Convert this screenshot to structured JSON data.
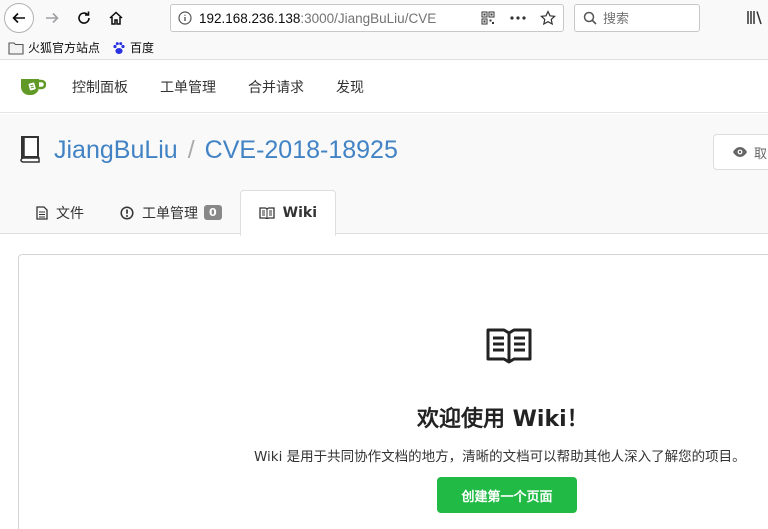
{
  "browser": {
    "url_host": "192.168.236.138",
    "url_rest": ":3000/JiangBuLiu/CVE",
    "search_placeholder": "搜索"
  },
  "bookmarks": [
    {
      "label": "火狐官方站点",
      "icon": "folder-icon"
    },
    {
      "label": "百度",
      "icon": "baidu-paw-icon"
    }
  ],
  "header": {
    "nav": [
      "控制面板",
      "工单管理",
      "合并请求",
      "发现"
    ]
  },
  "repo": {
    "owner": "JiangBuLiu",
    "separator": "/",
    "name": "CVE-2018-18925",
    "watch_label": "取"
  },
  "tabs": [
    {
      "label": "文件",
      "icon": "file-text-icon"
    },
    {
      "label": "工单管理",
      "icon": "issue-opened-icon",
      "count": "0"
    },
    {
      "label": "Wiki",
      "icon": "book-icon",
      "active": true
    }
  ],
  "wiki": {
    "heading": "欢迎使用 Wiki！",
    "description": "Wiki 是用于共同协作文档的地方，清晰的文档可以帮助其他人深入了解您的项目。",
    "create_button": "创建第一个页面"
  },
  "colors": {
    "link": "#4183c4",
    "primary_green": "#21ba45",
    "logo_green": "#609926"
  }
}
